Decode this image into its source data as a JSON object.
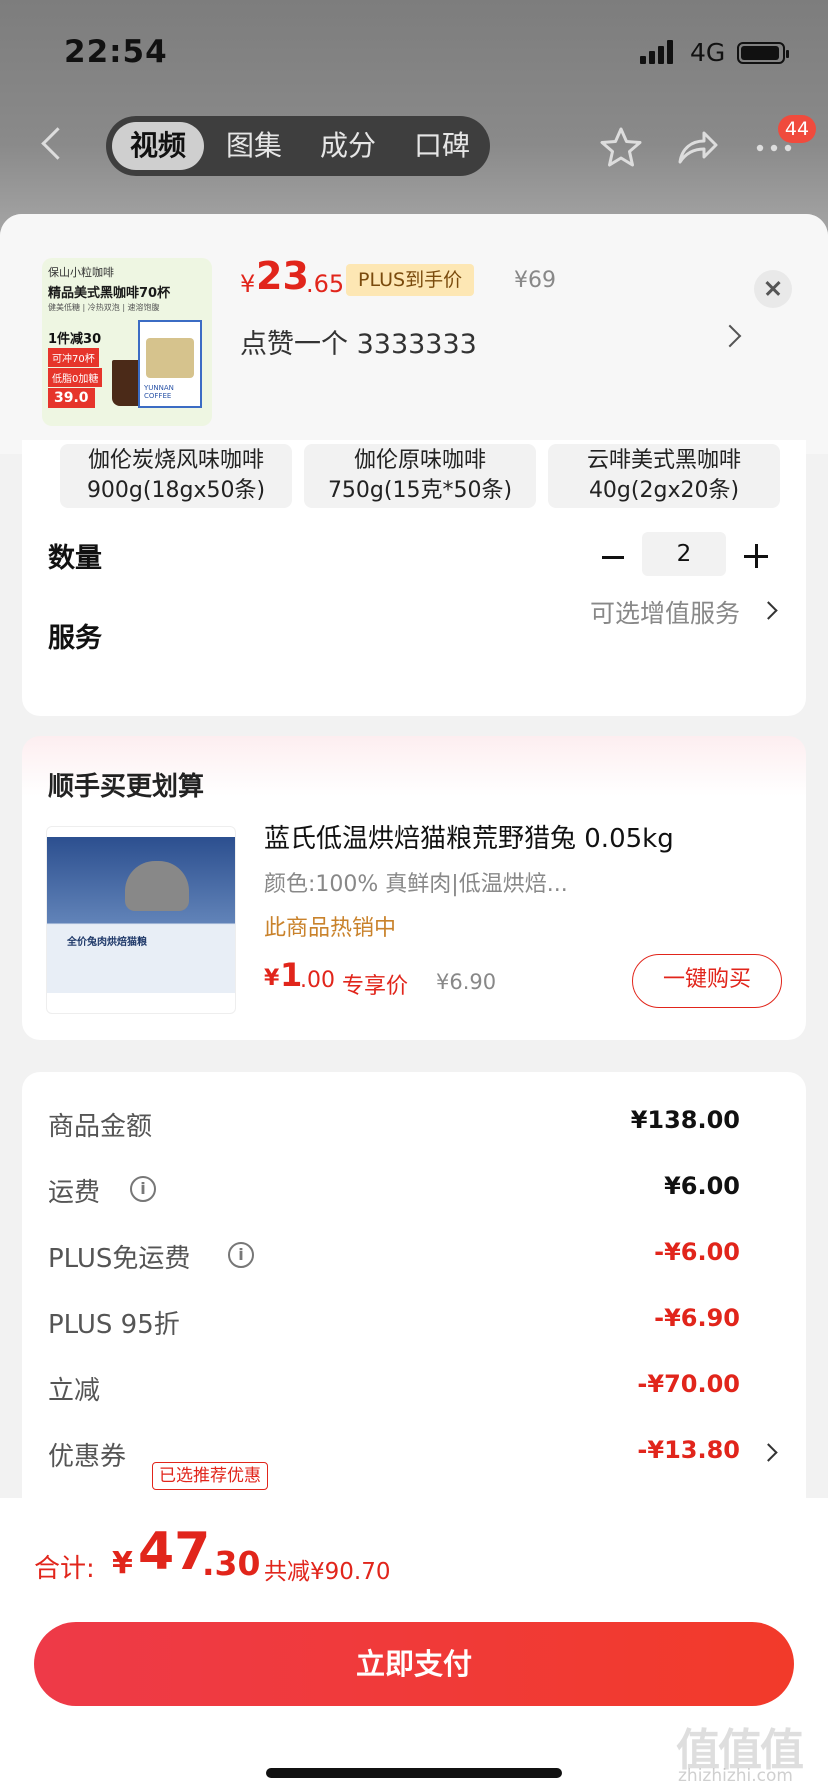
{
  "status_bar": {
    "time": "22:54",
    "network": "4G"
  },
  "nav": {
    "tabs": [
      {
        "label": "视频"
      },
      {
        "label": "图集"
      },
      {
        "label": "成分"
      },
      {
        "label": "口碑"
      }
    ],
    "active_tab": "视频",
    "badge_count": "44"
  },
  "product": {
    "thumbnail_texts": {
      "brand": "保山小粒咖啡",
      "headline": "精品美式黑咖啡70杯",
      "tagline": "健美低糖 | 冷热双泡 | 速溶饱腹",
      "promo1": "1件减30",
      "promo2": "可冲70杯",
      "promo3": "低脂0加糖",
      "promo4": "39.0",
      "box_label": "YUNNAN COFFEE"
    },
    "price_currency": "¥",
    "price_integer": "23",
    "price_decimal": ".65",
    "plus_tag": "PLUS到手价",
    "original_price": "¥69",
    "selected_spec": "点赞一个  3333333"
  },
  "specs": [
    {
      "line1": "伽伦炭烧风味咖啡",
      "line2": "900g(18gx50条)"
    },
    {
      "line1": "伽伦原味咖啡",
      "line2": "750g(15克*50条)"
    },
    {
      "line1": "云啡美式黑咖啡",
      "line2": "40g(2gx20条)"
    }
  ],
  "quantity": {
    "label": "数量",
    "value": "2"
  },
  "service": {
    "label": "服务",
    "hint": "可选增值服务"
  },
  "recommend": {
    "title": "顺手买更划算",
    "name": "蓝氏低温烘焙猫粮荒野猎兔 0.05kg",
    "attr": "颜色:100% 真鲜肉|低温烘焙...",
    "hot": "此商品热销中",
    "price_currency": "¥",
    "price_integer": "1",
    "price_decimal": ".00",
    "exclusive_label": "专享价",
    "original_price": "¥6.90",
    "buy_label": "一键购买",
    "package_text": "全价兔肉烘焙猫粮"
  },
  "fees": [
    {
      "label": "商品金额",
      "value": "¥138.00"
    },
    {
      "label": "运费",
      "value": "¥6.00"
    },
    {
      "label": "PLUS免运费",
      "value": "-¥6.00"
    },
    {
      "label": "PLUS 95折",
      "value": "-¥6.90"
    },
    {
      "label": "立减",
      "value": "-¥70.00"
    },
    {
      "label": "优惠券",
      "value": "-¥13.80",
      "tag": "已选推荐优惠"
    }
  ],
  "footer": {
    "total_label": "合计:",
    "total_currency": "¥",
    "total_integer": "47",
    "total_decimal": ".30",
    "total_saved": "共减¥90.70",
    "pay_label": "立即支付"
  },
  "watermark": {
    "main": "值值值",
    "sub": "zhizhizhi.com"
  },
  "colors": {
    "accent_red": "#e1251b",
    "plus_gold": "#fde7b4",
    "hot_orange": "#c9822b"
  }
}
